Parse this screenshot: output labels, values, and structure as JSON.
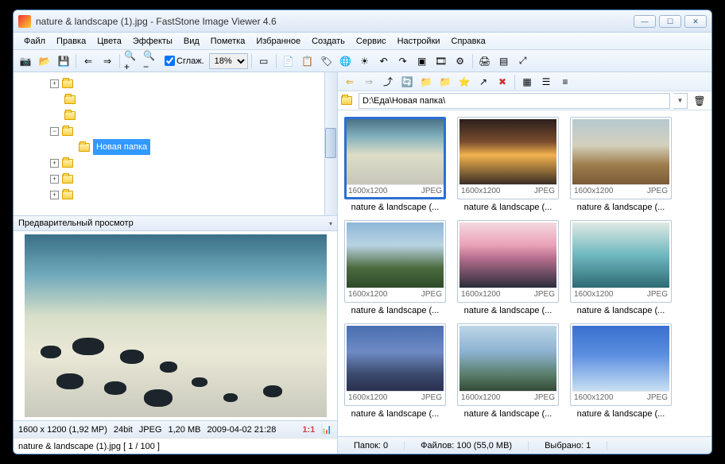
{
  "title": "nature & landscape (1).jpg  -  FastStone Image Viewer 4.6",
  "menu": [
    "Файл",
    "Правка",
    "Цвета",
    "Эффекты",
    "Вид",
    "Пометка",
    "Избранное",
    "Создать",
    "Сервис",
    "Настройки",
    "Справка"
  ],
  "toolbar": {
    "smoothing_label": "Сглаж.",
    "zoom_value": "18%"
  },
  "tree": {
    "selected_label": "Новая папка"
  },
  "preview": {
    "title": "Предварительный просмотр"
  },
  "image_info": {
    "dimensions": "1600 x 1200 (1,92 MP)",
    "depth": "24bit",
    "format": "JPEG",
    "size": "1,20 MB",
    "date": "2009-04-02 21:28",
    "ratio_label": "1:1"
  },
  "status_left_file": "nature & landscape (1).jpg  [ 1 / 100 ]",
  "path": {
    "value": "D:\\Еда\\Новая папка\\"
  },
  "thumb_meta": {
    "res": "1600x1200",
    "type": "JPEG"
  },
  "thumbs": [
    {
      "name": "nature & landscape (...",
      "cls": "p1",
      "selected": true
    },
    {
      "name": "nature & landscape (...",
      "cls": "p2"
    },
    {
      "name": "nature & landscape (...",
      "cls": "p3"
    },
    {
      "name": "nature & landscape (...",
      "cls": "p4"
    },
    {
      "name": "nature & landscape (...",
      "cls": "p5"
    },
    {
      "name": "nature & landscape (...",
      "cls": "p6"
    },
    {
      "name": "nature & landscape (...",
      "cls": "p7"
    },
    {
      "name": "nature & landscape (...",
      "cls": "p8"
    },
    {
      "name": "nature & landscape (...",
      "cls": "p9"
    }
  ],
  "status_bottom": {
    "folders": "Папок: 0",
    "files": "Файлов: 100 (55,0 MB)",
    "selected": "Выбрано: 1"
  },
  "icons": {
    "camera": "📷",
    "open": "📂",
    "save": "💾",
    "prev": "⇐",
    "next": "⇒",
    "zoom_in": "🔍+",
    "zoom_out": "🔍−",
    "select": "▭",
    "copy": "📄",
    "clip": "📋",
    "tag": "🏷",
    "globe": "🌐",
    "sun": "☀",
    "undo": "↶",
    "redo": "↷",
    "crop": "▣",
    "film": "🎞",
    "settings": "⚙",
    "print": "🖨",
    "panel": "▤",
    "full": "⤢",
    "back": "⇐",
    "forward": "⇒",
    "up": "⤴",
    "refresh": "🔄",
    "fold1": "📁",
    "fold2": "📁",
    "star": "⭐",
    "export": "↗",
    "del": "✖",
    "v1": "▦",
    "v2": "☰",
    "v3": "≡",
    "trash": "🗑",
    "hist": "📊"
  }
}
